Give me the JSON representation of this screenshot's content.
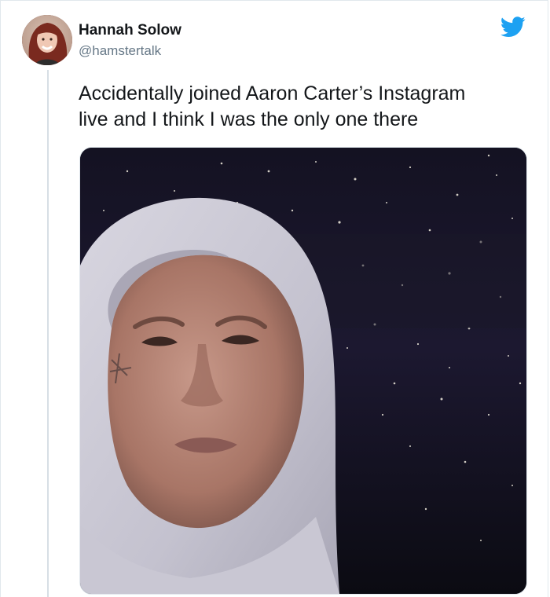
{
  "tweet": {
    "author": {
      "display_name": "Hannah Solow",
      "handle": "@hamstertalk"
    },
    "text_line1": "Accidentally joined Aaron Carter’s Instagram",
    "text_line2": "live and I think I was the only one there"
  },
  "icons": {
    "brand": "twitter-bird-icon"
  },
  "colors": {
    "twitter_blue": "#1da1f2",
    "text_primary": "#14171a",
    "text_secondary": "#657786"
  }
}
